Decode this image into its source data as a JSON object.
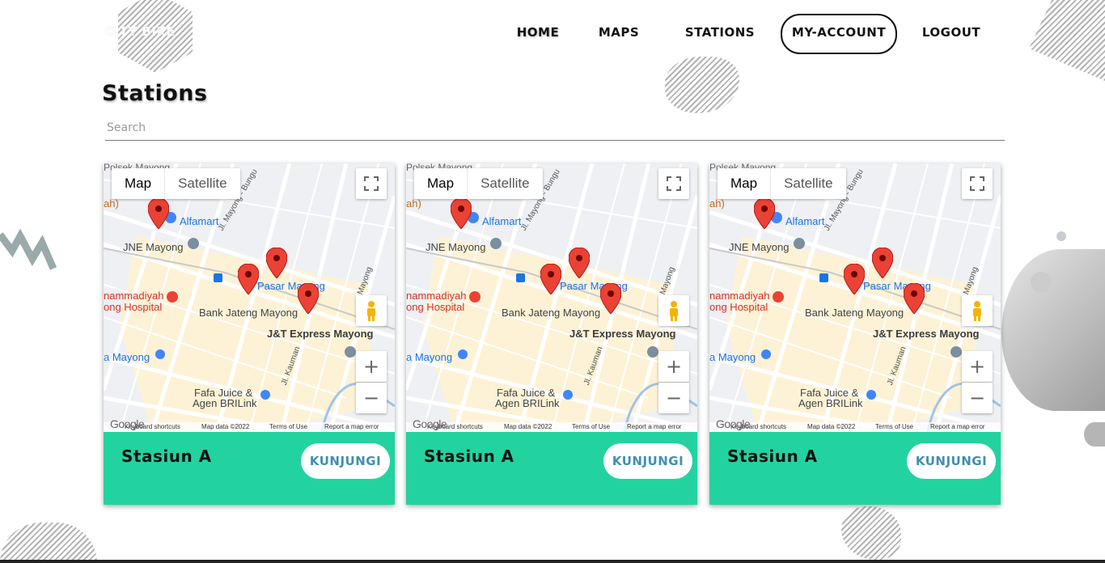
{
  "nav": {
    "logo": "CITY BIKE",
    "home": "HOME",
    "maps": "MAPS",
    "stations": "STATIONS",
    "account": "MY-ACCOUNT",
    "logout": "LOGOUT"
  },
  "page": {
    "title": "Stations"
  },
  "search": {
    "placeholder": "Search"
  },
  "map": {
    "toggle_map": "Map",
    "toggle_satellite": "Satellite",
    "places": {
      "alfamart": "Alfamart",
      "jne": "JNE Mayong",
      "pasar": "Pasar Mayong",
      "hospital_1": "nammadiyah",
      "hospital_2": "ong Hospital",
      "bank": "Bank Jateng Mayong",
      "jt": "J&T Express Mayong",
      "mayong": "a Mayong",
      "fafa_1": "Fafa Juice &",
      "fafa_2": "Agen BRILink",
      "polsek": "Polsek Mayong",
      "left_edge": "ah)"
    },
    "streets": {
      "bungu": "Jl. Mayong - Bungu",
      "mayong": "Mayong",
      "kauman": "Jl. Kauman"
    },
    "attribution": {
      "shortcuts": "Keyboard shortcuts",
      "data": "Map data ©2022",
      "terms": "Terms of Use",
      "report": "Report a map error"
    },
    "google": "Google",
    "zoom_in": "+",
    "zoom_out": "−"
  },
  "stations": [
    {
      "name": "Stasiun A",
      "button": "KUNJUNGI"
    },
    {
      "name": "Stasiun A",
      "button": "KUNJUNGI"
    },
    {
      "name": "Stasiun A",
      "button": "KUNJUNGI"
    }
  ],
  "colors": {
    "card_footer": "#22d3a0",
    "button_text": "#3f8fb0"
  }
}
